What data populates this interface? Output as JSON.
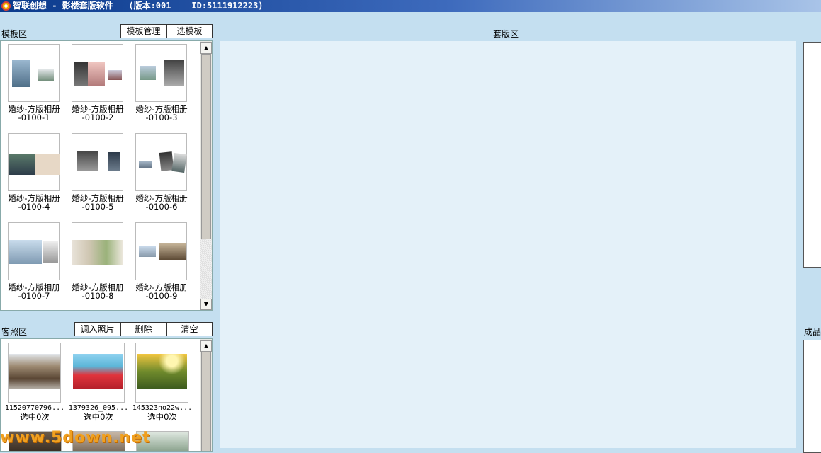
{
  "titlebar": {
    "title": "智联创想 - 影楼套版软件   (版本:001    ID:5111912223)"
  },
  "template_area": {
    "label": "模板区",
    "manage_button": "模板管理",
    "select_button": "选模板",
    "templates": [
      {
        "line1": "婚纱-方版相册",
        "line2": "-0100-1"
      },
      {
        "line1": "婚纱-方版相册",
        "line2": "-0100-2"
      },
      {
        "line1": "婚纱-方版相册",
        "line2": "-0100-3"
      },
      {
        "line1": "婚纱-方版相册",
        "line2": "-0100-4"
      },
      {
        "line1": "婚纱-方版相册",
        "line2": "-0100-5"
      },
      {
        "line1": "婚纱-方版相册",
        "line2": "-0100-6"
      },
      {
        "line1": "婚纱-方版相册",
        "line2": "-0100-7"
      },
      {
        "line1": "婚纱-方版相册",
        "line2": "-0100-8"
      },
      {
        "line1": "婚纱-方版相册",
        "line2": "-0100-9"
      }
    ]
  },
  "client_area": {
    "label": "客照区",
    "import_button": "调入照片",
    "delete_button": "删除",
    "clear_button": "清空",
    "photos": [
      {
        "name": "11520770796...",
        "count": "选中0次"
      },
      {
        "name": "1379326_095...",
        "count": "选中0次"
      },
      {
        "name": "145323no22w...",
        "count": "选中0次"
      }
    ]
  },
  "layout_area": {
    "label": "套版区"
  },
  "result_area": {
    "label": "成品"
  },
  "watermark": "www.5down.net",
  "colors": {
    "background": "#c4dff0",
    "canvas": "#e4f1f9",
    "titlebar": "#0a3a8c",
    "watermark": "#f0a020"
  }
}
